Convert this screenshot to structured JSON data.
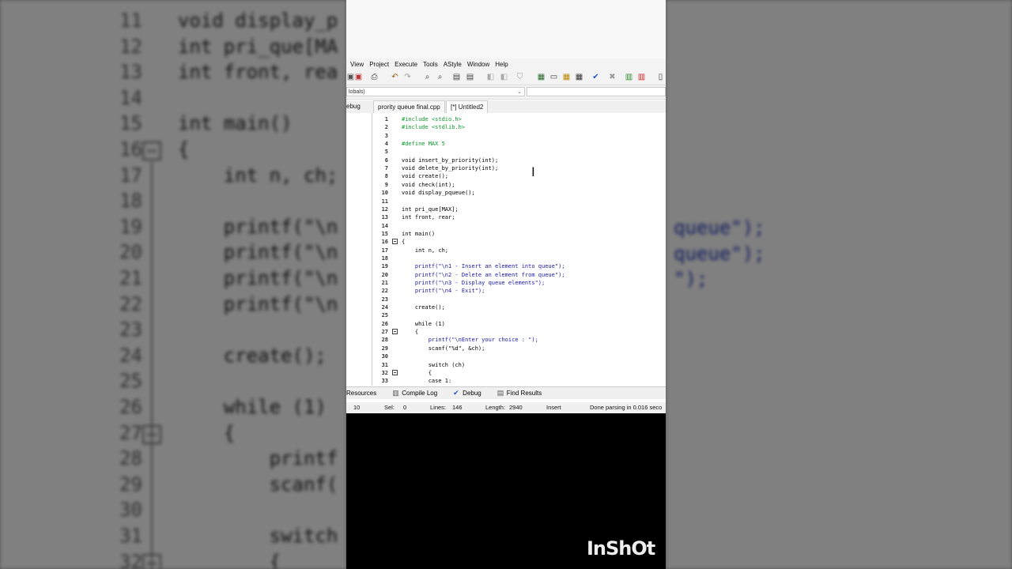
{
  "menu": [
    "View",
    "Project",
    "Execute",
    "Tools",
    "AStyle",
    "Window",
    "Help"
  ],
  "scope_combo": "lobals)",
  "left_tab": "ebug",
  "file_tabs": [
    {
      "label": "prority queue final.cpp",
      "active": false
    },
    {
      "label": "[*] Untitled2",
      "active": true
    }
  ],
  "code_lines": [
    {
      "n": "1",
      "t": "#include <stdio.h>",
      "c": "pp"
    },
    {
      "n": "2",
      "t": "#include <stdlib.h>",
      "c": "pp"
    },
    {
      "n": "3",
      "t": "",
      "c": ""
    },
    {
      "n": "4",
      "t": "#define MAX 5",
      "c": "pp"
    },
    {
      "n": "5",
      "t": "",
      "c": ""
    },
    {
      "n": "6",
      "t": "void insert_by_priority(int);",
      "c": ""
    },
    {
      "n": "7",
      "t": "void delete_by_priority(int);",
      "c": ""
    },
    {
      "n": "8",
      "t": "void create();",
      "c": ""
    },
    {
      "n": "9",
      "t": "void check(int);",
      "c": ""
    },
    {
      "n": "10",
      "t": "void display_pqueue();",
      "c": ""
    },
    {
      "n": "11",
      "t": "",
      "c": ""
    },
    {
      "n": "12",
      "t": "int pri_que[MAX];",
      "c": ""
    },
    {
      "n": "13",
      "t": "int front, rear;",
      "c": ""
    },
    {
      "n": "14",
      "t": "",
      "c": ""
    },
    {
      "n": "15",
      "t": "int main()",
      "c": ""
    },
    {
      "n": "16",
      "t": "{",
      "c": "",
      "fold": true
    },
    {
      "n": "17",
      "t": "    int n, ch;",
      "c": ""
    },
    {
      "n": "18",
      "t": "",
      "c": ""
    },
    {
      "n": "19",
      "t": "    printf(\"\\n1 - Insert an element into queue\");",
      "c": "str"
    },
    {
      "n": "20",
      "t": "    printf(\"\\n2 - Delete an element from queue\");",
      "c": "str"
    },
    {
      "n": "21",
      "t": "    printf(\"\\n3 - Display queue elements\");",
      "c": "str"
    },
    {
      "n": "22",
      "t": "    printf(\"\\n4 - Exit\");",
      "c": "str"
    },
    {
      "n": "23",
      "t": "",
      "c": ""
    },
    {
      "n": "24",
      "t": "    create();",
      "c": ""
    },
    {
      "n": "25",
      "t": "",
      "c": ""
    },
    {
      "n": "26",
      "t": "    while (1)",
      "c": ""
    },
    {
      "n": "27",
      "t": "    {",
      "c": "",
      "fold": true
    },
    {
      "n": "28",
      "t": "        printf(\"\\nEnter your choice : \");",
      "c": "str"
    },
    {
      "n": "29",
      "t": "        scanf(\"%d\", &ch);",
      "c": ""
    },
    {
      "n": "30",
      "t": "",
      "c": ""
    },
    {
      "n": "31",
      "t": "        switch (ch)",
      "c": ""
    },
    {
      "n": "32",
      "t": "        {",
      "c": "",
      "fold": true
    },
    {
      "n": "33",
      "t": "        case 1:",
      "c": ""
    }
  ],
  "bottom_tabs": [
    "Resources",
    "Compile Log",
    "Debug",
    "Find Results"
  ],
  "status": {
    "line": "10",
    "sel_label": "Sel:",
    "sel": "0",
    "lines_label": "Lines:",
    "lines": "146",
    "length_label": "Length:",
    "length": "2940",
    "mode": "Insert",
    "message": "Done parsing in 0.016 seco"
  },
  "watermark": "InShOt",
  "bg_left_lines": [
    {
      "n": "11",
      "t": "void display_p"
    },
    {
      "n": "12",
      "t": "int pri_que[MA"
    },
    {
      "n": "13",
      "t": "int front, rea"
    },
    {
      "n": "14",
      "t": ""
    },
    {
      "n": "15",
      "t": "int main()"
    },
    {
      "n": "16",
      "t": "{"
    },
    {
      "n": "17",
      "t": "    int n, ch;"
    },
    {
      "n": "18",
      "t": ""
    },
    {
      "n": "19",
      "t": "    printf(\"\\n"
    },
    {
      "n": "20",
      "t": "    printf(\"\\n"
    },
    {
      "n": "21",
      "t": "    printf(\"\\n"
    },
    {
      "n": "22",
      "t": "    printf(\"\\n"
    },
    {
      "n": "23",
      "t": ""
    },
    {
      "n": "24",
      "t": "    create();"
    },
    {
      "n": "25",
      "t": ""
    },
    {
      "n": "26",
      "t": "    while (1)"
    },
    {
      "n": "27",
      "t": "    {"
    },
    {
      "n": "28",
      "t": "        printf"
    },
    {
      "n": "29",
      "t": "        scanf("
    },
    {
      "n": "30",
      "t": ""
    },
    {
      "n": "31",
      "t": "        switch"
    },
    {
      "n": "32",
      "t": "        {"
    }
  ],
  "bg_right_lines": [
    {
      "t": "queue\");"
    },
    {
      "t": "queue\");"
    },
    {
      "t": "\");"
    }
  ]
}
